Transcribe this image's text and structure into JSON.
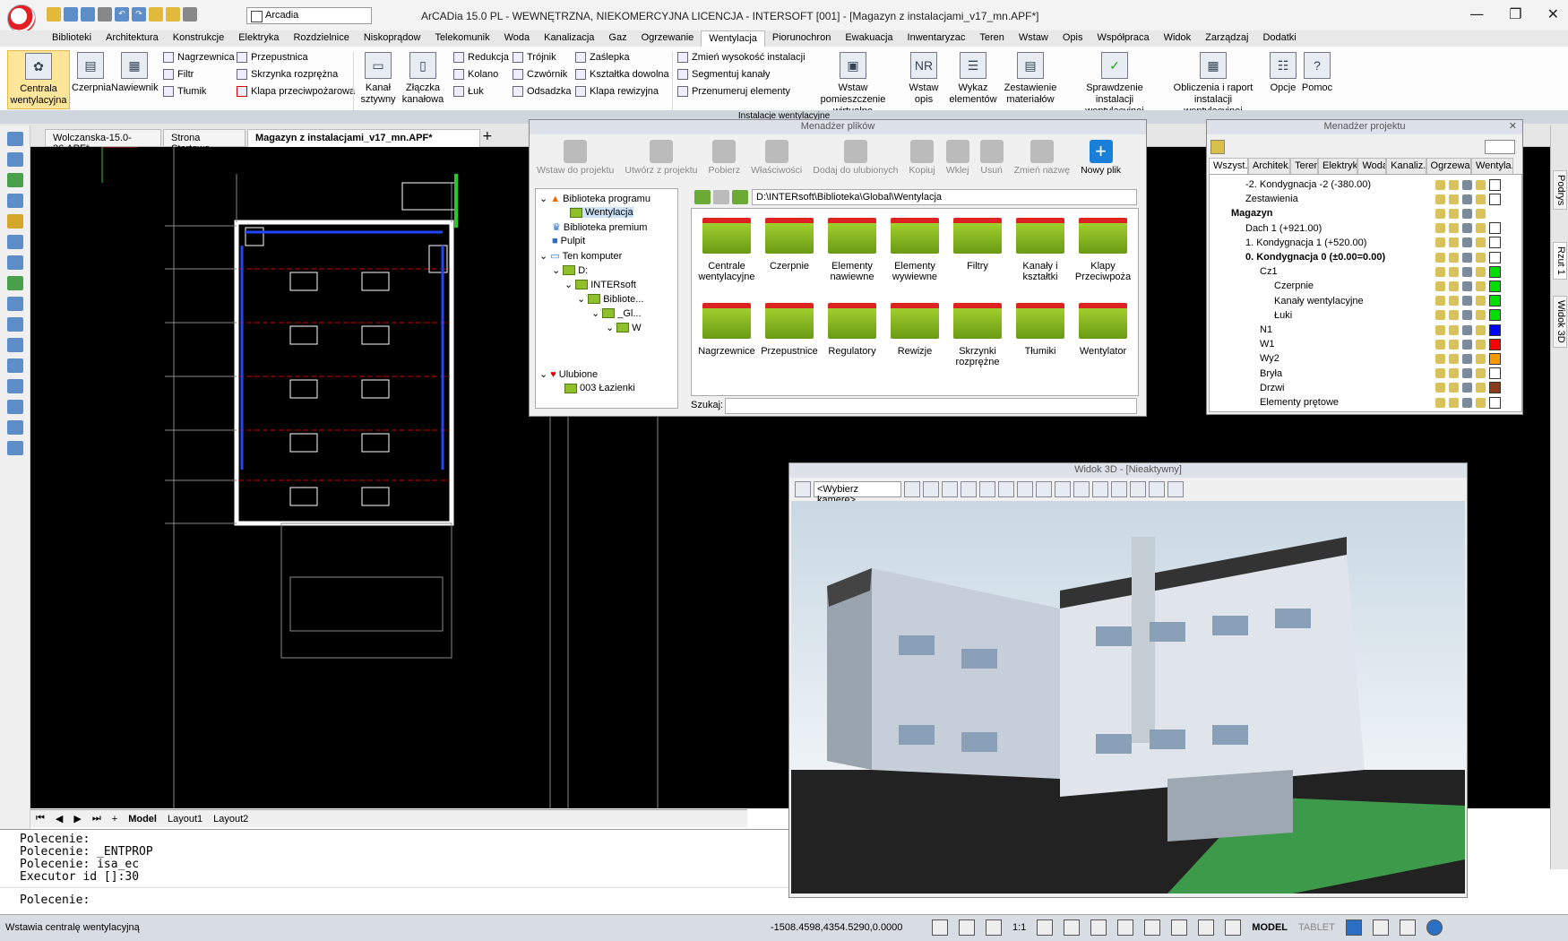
{
  "app": {
    "title": "ArCADia 15.0 PL - WEWNĘTRZNA, NIEKOMERCYJNA LICENCJA - INTERSOFT [001] - [Magazyn z instalacjami_v17_mn.APF*]",
    "profile": "Arcadia",
    "window_minimize": "—",
    "window_restore": "❐",
    "window_close": "✕"
  },
  "menu": [
    "Biblioteki",
    "Architektura",
    "Konstrukcje",
    "Elektryka",
    "Rozdzielnice",
    "Niskoprądow",
    "Telekomunik",
    "Woda",
    "Kanalizacja",
    "Gaz",
    "Ogrzewanie",
    "Wentylacja",
    "Piorunochron",
    "Ewakuacja",
    "Inwentaryzac",
    "Teren",
    "Wstaw",
    "Opis",
    "Współpraca",
    "Widok",
    "Zarządzaj",
    "Dodatki"
  ],
  "menu_active": "Wentylacja",
  "ribbon": {
    "group_title": "Instalacje wentylacyjne",
    "centrala": "Centrala wentylacyjna",
    "czerpnia": "Czerpnia",
    "nawiewnik": "Nawiewnik",
    "nagrzewnica": "Nagrzewnica",
    "filtr": "Filtr",
    "tlumik": "Tłumik",
    "przepustnica": "Przepustnica",
    "skrzynka": "Skrzynka rozprężna",
    "klapa": "Klapa przeciwpożarowa",
    "kanal": "Kanał sztywny",
    "zlaczka": "Złączka kanałowa",
    "redukcja": "Redukcja",
    "kolano": "Kolano",
    "luk": "Łuk",
    "trojnik": "Trójnik",
    "czwornik": "Czwórnik",
    "odsadzka": "Odsadzka",
    "zaslepka": "Zaślepka",
    "ksztaltka": "Kształtka dowolna",
    "klapa_rew": "Klapa rewizyjna",
    "zmien_wys": "Zmień wysokość instalacji",
    "segmentuj": "Segmentuj kanały",
    "przenumeruj": "Przenumeruj elementy",
    "wstaw_pom": "Wstaw pomieszczenie wirtualne",
    "wstaw_opis": "Wstaw opis",
    "wykaz": "Wykaz elementów",
    "zestawienie": "Zestawienie materiałów",
    "sprawdzenie": "Sprawdzenie instalacji wentylacyjnej",
    "obliczenia": "Obliczenia i raport instalacji wentylacyjnej",
    "opcje": "Opcje",
    "pomoc": "Pomoc"
  },
  "doc_tabs": [
    "Wolczanska-15.0-36.APF*",
    "Strona Startowa",
    "Magazyn z instalacjami_v17_mn.APF*"
  ],
  "layout_tabs": {
    "model": "Model",
    "layout1": "Layout1",
    "layout2": "Layout2"
  },
  "command_lines": [
    "Polecenie:",
    "Polecenie: _ENTPROP",
    "Polecenie: isa_ec",
    "Executor id []:30"
  ],
  "command_prompt": "Polecenie:",
  "status": {
    "message": "Wstawia centralę wentylacyjną",
    "coords": "-1508.4598,4354.5290,0.0000",
    "scale": "1:1",
    "model": "MODEL",
    "tablet": "TABLET"
  },
  "file_manager": {
    "title": "Menadżer plików",
    "toolbar": [
      "Wstaw do projektu",
      "Utwórz z projektu",
      "Pobierz",
      "Właściwości",
      "Dodaj do ulubionych",
      "Kopiuj",
      "Wklej",
      "Usuń",
      "Zmień nazwę",
      "Nowy plik"
    ],
    "tree": [
      "Biblioteka programu",
      "Wentylacja",
      "Biblioteka premium",
      "Pulpit",
      "Ten komputer",
      "D:",
      "INTERsoft",
      "Bibliote...",
      "_Gl...",
      "W",
      "Ulubione",
      "003 Łazienki"
    ],
    "path": "D:\\INTERsoft\\Biblioteka\\Global\\Wentylacja",
    "folders": [
      "Centrale wentylacyjne",
      "Czerpnie",
      "Elementy nawiewne",
      "Elementy wywiewne",
      "Filtry",
      "Kanały i kształtki",
      "Klapy Przeciwpoża",
      "Nagrzewnice",
      "Przepustnice",
      "Regulatory",
      "Rewizje",
      "Skrzynki rozprężne",
      "Tłumiki",
      "Wentylator"
    ],
    "search_label": "Szukaj:"
  },
  "project_manager": {
    "title": "Menadżer projektu",
    "tabs": [
      "Wszyst...",
      "Architek...",
      "Teren",
      "Elektryka",
      "Woda",
      "Kanaliz...",
      "Ogrzewa...",
      "Wentyla..."
    ],
    "rows": [
      {
        "label": "-2. Kondygnacja -2 (-380.00)",
        "level": 2,
        "bold": false,
        "swatch": "#ffffff"
      },
      {
        "label": "Zestawienia",
        "level": 2,
        "bold": false,
        "swatch": "#ffffff"
      },
      {
        "label": "Magazyn",
        "level": 1,
        "bold": true,
        "swatch": ""
      },
      {
        "label": "Dach 1 (+921.00)",
        "level": 2,
        "bold": false,
        "swatch": "#ffffff"
      },
      {
        "label": "1. Kondygnacja 1 (+520.00)",
        "level": 2,
        "bold": false,
        "swatch": "#ffffff"
      },
      {
        "label": "0. Kondygnacja 0 (±0.00=0.00)",
        "level": 2,
        "bold": true,
        "swatch": "#ffffff"
      },
      {
        "label": "Cz1",
        "level": 3,
        "bold": false,
        "swatch": "#00dd00"
      },
      {
        "label": "Czerpnie",
        "level": 4,
        "bold": false,
        "swatch": "#00dd00"
      },
      {
        "label": "Kanały wentylacyjne",
        "level": 4,
        "bold": false,
        "swatch": "#00dd00"
      },
      {
        "label": "Łuki",
        "level": 4,
        "bold": false,
        "swatch": "#00dd00"
      },
      {
        "label": "N1",
        "level": 3,
        "bold": false,
        "swatch": "#0000ff"
      },
      {
        "label": "W1",
        "level": 3,
        "bold": false,
        "swatch": "#ff0000"
      },
      {
        "label": "Wy2",
        "level": 3,
        "bold": false,
        "swatch": "#ff9900"
      },
      {
        "label": "Bryła",
        "level": 3,
        "bold": false,
        "swatch": "#ffffff"
      },
      {
        "label": "Drzwi",
        "level": 3,
        "bold": false,
        "swatch": "#8b3a1a"
      },
      {
        "label": "Elementy prętowe",
        "level": 3,
        "bold": false,
        "swatch": "#ffffff"
      }
    ]
  },
  "side_tabs": [
    "Podrys",
    "Rzut 1",
    "Widok 3D"
  ],
  "view3d": {
    "title": "Widok 3D - [Nieaktywny]",
    "camera": "<Wybierz kamerę>"
  },
  "colors": {
    "accent": "#2b6fc4",
    "ribbon_selected": "#fde59a",
    "cad_bg": "#000000"
  }
}
